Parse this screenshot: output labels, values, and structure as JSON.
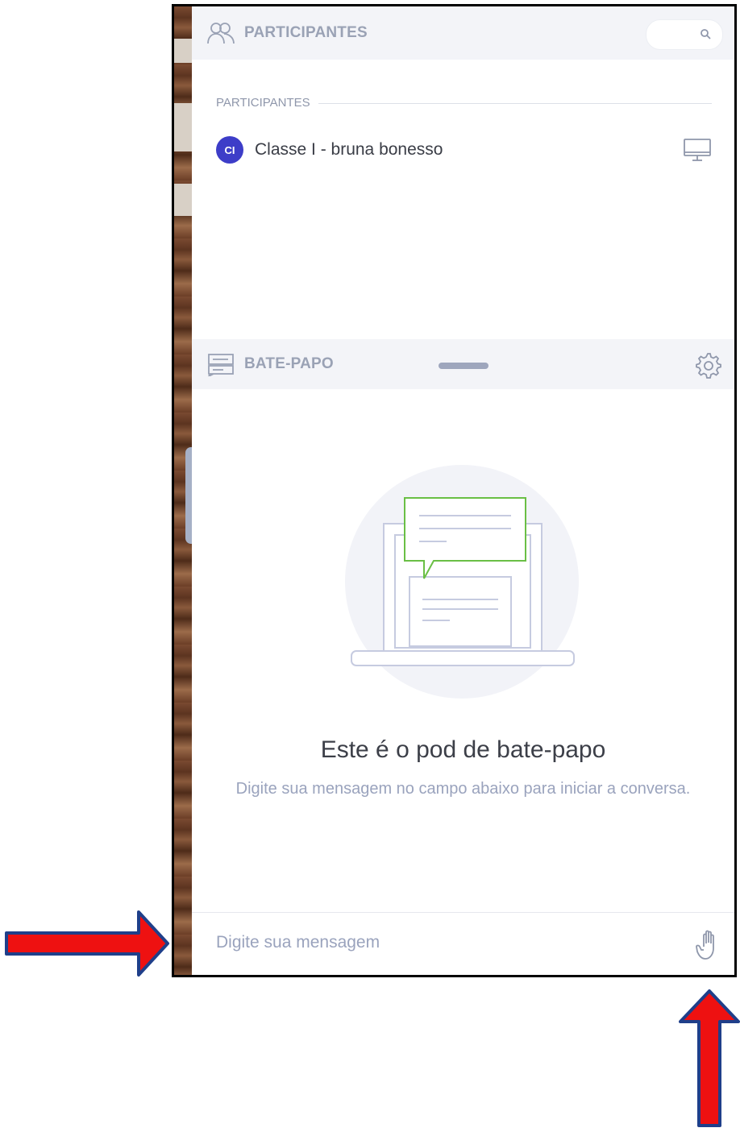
{
  "participants_pod": {
    "header_title": "PARTICIPANTES",
    "section_label": "PARTICIPANTES",
    "participants": [
      {
        "initials": "CI",
        "name": "Classe I - bruna bonesso",
        "device_icon": "monitor-icon"
      }
    ]
  },
  "chat_pod": {
    "header_title": "BATE-PAPO",
    "empty_title": "Este é o pod de bate-papo",
    "empty_subtitle": "Digite sua mensagem no campo abaixo para iniciar a conversa.",
    "input_placeholder": "Digite sua mensagem",
    "raise_hand_icon": "hand-icon",
    "settings_icon": "gear-icon"
  },
  "colors": {
    "header_bg": "#f3f4f8",
    "header_text": "#9aa2b5",
    "avatar_bg": "#3d3dc8",
    "illustration_accent": "#6abf45",
    "annotation_arrow": "#ee1111"
  }
}
